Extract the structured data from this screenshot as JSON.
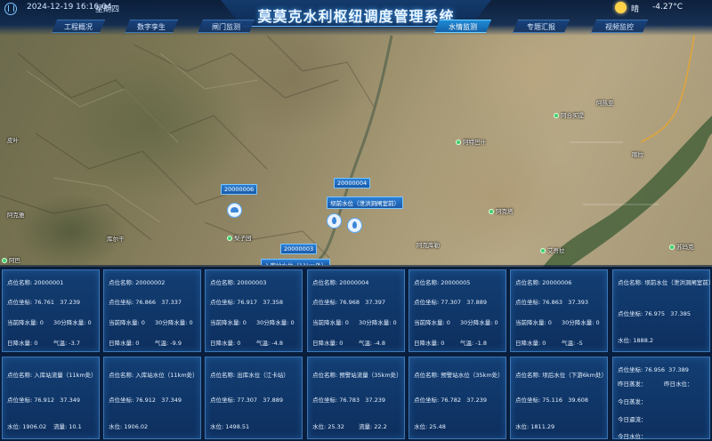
{
  "header": {
    "datetime": "2024-12-19 16:16:04",
    "weekday": "星期四",
    "title": "莫莫克水利枢纽调度管理系统",
    "weather": "晴",
    "temperature": "-4.27°C"
  },
  "nav": {
    "tabs": [
      {
        "label": "工程概况",
        "active": false
      },
      {
        "label": "数字孪生",
        "active": false
      },
      {
        "label": "闸门监测",
        "active": false
      },
      {
        "label": "水情监测",
        "active": true
      },
      {
        "label": "专题汇报",
        "active": false
      },
      {
        "label": "视频监控",
        "active": false
      }
    ]
  },
  "map": {
    "places": [
      "梨子园",
      "阿巴",
      "阿合买提",
      "阿特巴什",
      "阿克塔",
      "艾吾拉",
      "苏玛克",
      "皮叶",
      "阿克雅",
      "库尔干",
      "阿克库勒",
      "喀拉",
      "阿热亚"
    ],
    "markers": [
      {
        "code": "20000006",
        "caption": ""
      },
      {
        "code": "20000004",
        "caption": "坝前水位（泄洪洞闸室前）"
      },
      {
        "code": "20000003",
        "caption": "入库站水位（11km处）"
      }
    ]
  },
  "cards": {
    "top": [
      {
        "name_label": "点位名称:",
        "name": "20000001",
        "coord_label": "点位坐标:",
        "x": "76.761",
        "y": "37.239",
        "cur_rain_label": "当前降水量:",
        "cur_rain": "0",
        "rain30_label": "30分降水量:",
        "rain30": "0",
        "day_rain_label": "日降水量:",
        "day_rain": "0",
        "temp_label": "气温:",
        "temp": "-3.7"
      },
      {
        "name_label": "点位名称:",
        "name": "20000002",
        "coord_label": "点位坐标:",
        "x": "76.866",
        "y": "37.337",
        "cur_rain_label": "当前降水量:",
        "cur_rain": "0",
        "rain30_label": "30分降水量:",
        "rain30": "0",
        "day_rain_label": "日降水量:",
        "day_rain": "0",
        "temp_label": "气温:",
        "temp": "-9.9"
      },
      {
        "name_label": "点位名称:",
        "name": "20000003",
        "coord_label": "点位坐标:",
        "x": "76.917",
        "y": "37.358",
        "cur_rain_label": "当前降水量:",
        "cur_rain": "0",
        "rain30_label": "30分降水量:",
        "rain30": "0",
        "day_rain_label": "日降水量:",
        "day_rain": "0",
        "temp_label": "气温:",
        "temp": "-4.8"
      },
      {
        "name_label": "点位名称:",
        "name": "20000004",
        "coord_label": "点位坐标:",
        "x": "76.968",
        "y": "37.397",
        "cur_rain_label": "当前降水量:",
        "cur_rain": "0",
        "rain30_label": "30分降水量:",
        "rain30": "0",
        "day_rain_label": "日降水量:",
        "day_rain": "0",
        "temp_label": "气温:",
        "temp": "-4.8"
      },
      {
        "name_label": "点位名称:",
        "name": "20000005",
        "coord_label": "点位坐标:",
        "x": "77.307",
        "y": "37.889",
        "cur_rain_label": "当前降水量:",
        "cur_rain": "0",
        "rain30_label": "30分降水量:",
        "rain30": "0",
        "day_rain_label": "日降水量:",
        "day_rain": "0",
        "temp_label": "气温:",
        "temp": "-1.8"
      },
      {
        "name_label": "点位名称:",
        "name": "20000006",
        "coord_label": "点位坐标:",
        "x": "76.863",
        "y": "37.393",
        "cur_rain_label": "当前降水量:",
        "cur_rain": "0",
        "rain30_label": "30分降水量:",
        "rain30": "0",
        "day_rain_label": "日降水量:",
        "day_rain": "0",
        "temp_label": "气温:",
        "temp": "-5"
      }
    ],
    "top_last": {
      "name_label": "点位名称:",
      "name": "坝前水位（泄洪洞闸室前）",
      "coord_label": "点位坐标:",
      "x": "76.975",
      "y": "37.385",
      "level_label": "水位:",
      "level": "1888.2"
    },
    "bottom": [
      {
        "name_label": "点位名称:",
        "name": "入库站流量（11km处）",
        "coord_label": "点位坐标:",
        "x": "76.912",
        "y": "37.349",
        "v1_label": "水位:",
        "v1": "1906.02",
        "v2_label": "流量:",
        "v2": "10.1"
      },
      {
        "name_label": "点位名称:",
        "name": "入库站水位（11km处）",
        "coord_label": "点位坐标:",
        "x": "76.912",
        "y": "37.349",
        "v1_label": "水位:",
        "v1": "1906.02",
        "v2_label": "",
        "v2": ""
      },
      {
        "name_label": "点位名称:",
        "name": "出库水位（江卡站）",
        "coord_label": "点位坐标:",
        "x": "77.307",
        "y": "37.889",
        "v1_label": "水位:",
        "v1": "1498.51",
        "v2_label": "",
        "v2": ""
      },
      {
        "name_label": "点位名称:",
        "name": "预警站流量（35km处）",
        "coord_label": "点位坐标:",
        "x": "76.783",
        "y": "37.239",
        "v1_label": "水位:",
        "v1": "25.32",
        "v2_label": "流量:",
        "v2": "22.2"
      },
      {
        "name_label": "点位名称:",
        "name": "预警站水位（35km处）",
        "coord_label": "点位坐标:",
        "x": "76.782",
        "y": "37.239",
        "v1_label": "水位:",
        "v1": "25.48",
        "v2_label": "",
        "v2": ""
      },
      {
        "name_label": "点位名称:",
        "name": "坝后水位（下游6km处）",
        "coord_label": "点位坐标:",
        "x": "75.116",
        "y": "39.608",
        "v1_label": "水位:",
        "v1": "1811.29",
        "v2_label": "",
        "v2": ""
      }
    ],
    "bottom_last": {
      "coord_label": "点位坐标:",
      "x": "76.956",
      "y": "37.389",
      "l1": "昨日蒸发：",
      "l2": "昨日水位：",
      "l3": "今日蒸发：",
      "l4": "今日逼流：",
      "l5": "今日水位："
    }
  },
  "colors": {
    "accent": "#1f8ad6",
    "card_bg": "#144076",
    "place_dot": "#3fcf6a"
  }
}
